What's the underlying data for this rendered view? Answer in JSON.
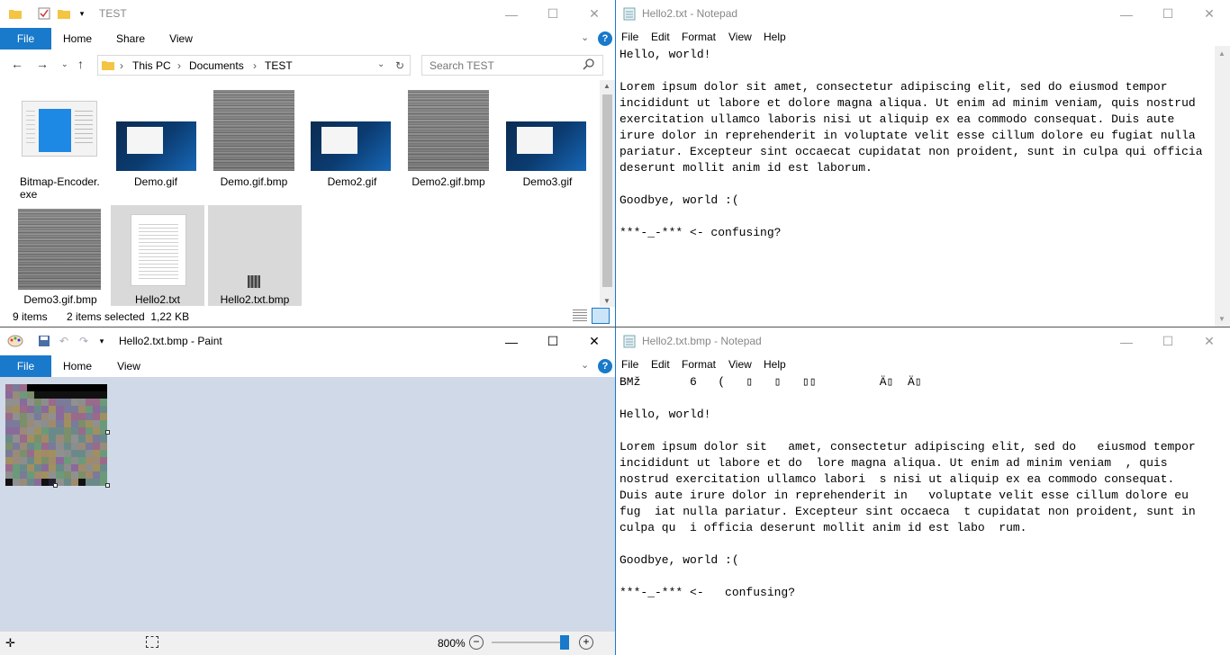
{
  "explorer": {
    "title": "TEST",
    "ribbon_tabs": [
      "File",
      "Home",
      "Share",
      "View"
    ],
    "breadcrumb": [
      "This PC",
      "Documents",
      "TEST"
    ],
    "search_placeholder": "Search TEST",
    "files": [
      {
        "name": "Bitmap-Encoder.\nexe",
        "kind": "app"
      },
      {
        "name": "Demo.gif",
        "kind": "desk"
      },
      {
        "name": "Demo.gif.bmp",
        "kind": "noise"
      },
      {
        "name": "Demo2.gif",
        "kind": "desk"
      },
      {
        "name": "Demo2.gif.bmp",
        "kind": "noise"
      },
      {
        "name": "Demo3.gif",
        "kind": "desk"
      },
      {
        "name": "Demo3.gif.bmp",
        "kind": "noise"
      },
      {
        "name": "Hello2.txt",
        "kind": "txt",
        "selected": true
      },
      {
        "name": "Hello2.txt.bmp",
        "kind": "smallbmp",
        "selected": true
      }
    ],
    "status_items": "9 items",
    "status_selected": "2 items selected  1,22 KB"
  },
  "notepad1": {
    "title": "Hello2.txt - Notepad",
    "menus": [
      "File",
      "Edit",
      "Format",
      "View",
      "Help"
    ],
    "text": "Hello, world!\n\nLorem ipsum dolor sit amet, consectetur adipiscing elit, sed do eiusmod tempor incididunt ut labore et dolore magna aliqua. Ut enim ad minim veniam, quis nostrud exercitation ullamco laboris nisi ut aliquip ex ea commodo consequat. Duis aute irure dolor in reprehenderit in voluptate velit esse cillum dolore eu fugiat nulla pariatur. Excepteur sint occaecat cupidatat non proident, sunt in culpa qui officia deserunt mollit anim id est laborum.\n\nGoodbye, world :(\n\n***-_-*** <- confusing?"
  },
  "paint": {
    "title": "Hello2.txt.bmp - Paint",
    "ribbon_tabs": [
      "File",
      "Home",
      "View"
    ],
    "zoom": "800%"
  },
  "notepad2": {
    "title": "Hello2.txt.bmp - Notepad",
    "menus": [
      "File",
      "Edit",
      "Format",
      "View",
      "Help"
    ],
    "text": "BMž       6   (   ▯   ▯   ▯▯         Ä▯  Ä▯\n\nHello, world!\n\nLorem ipsum dolor sit   amet, consectetur adipiscing elit, sed do   eiusmod tempor\nincididunt ut labore et do  lore magna aliqua. Ut enim ad minim veniam  , quis\nnostrud exercitation ullamco labori  s nisi ut aliquip ex ea commodo consequat.\nDuis aute irure dolor in reprehenderit in   voluptate velit esse cillum dolore eu\nfug  iat nulla pariatur. Excepteur sint occaeca  t cupidatat non proident, sunt in\nculpa qu  i officia deserunt mollit anim id est labo  rum.\n\nGoodbye, world :(\n\n***-_-*** <-   confusing?"
  },
  "colors": {
    "accent": "#1979ca",
    "paint_bg": "#cfd9e8",
    "selection": "#d9d9d9"
  }
}
